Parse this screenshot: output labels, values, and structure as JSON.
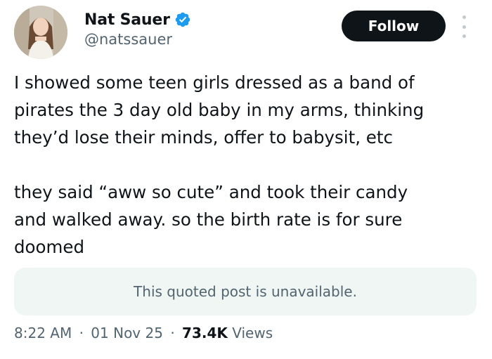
{
  "author": {
    "display_name": "Nat Sauer",
    "handle": "@natssauer",
    "verified_color": "#1d9bf0",
    "avatar_icon": "profile-photo"
  },
  "actions": {
    "follow_label": "Follow",
    "more_icon": "more-vertical-icon"
  },
  "tweet": {
    "lines": [
      "I showed some teen girls dressed as a band of",
      "pirates the 3 day old baby in my arms, thinking",
      "they’d lose their minds, offer to babysit, etc",
      "",
      "they said “aww so cute” and took their candy",
      "and walked away. so the birth rate is for sure",
      "doomed"
    ]
  },
  "quote": {
    "text": "This quoted post is unavailable."
  },
  "meta": {
    "time": "8:22 AM",
    "date": "01 Nov 25",
    "views_count": "73.4K",
    "views_label": "Views",
    "separator": "·"
  }
}
